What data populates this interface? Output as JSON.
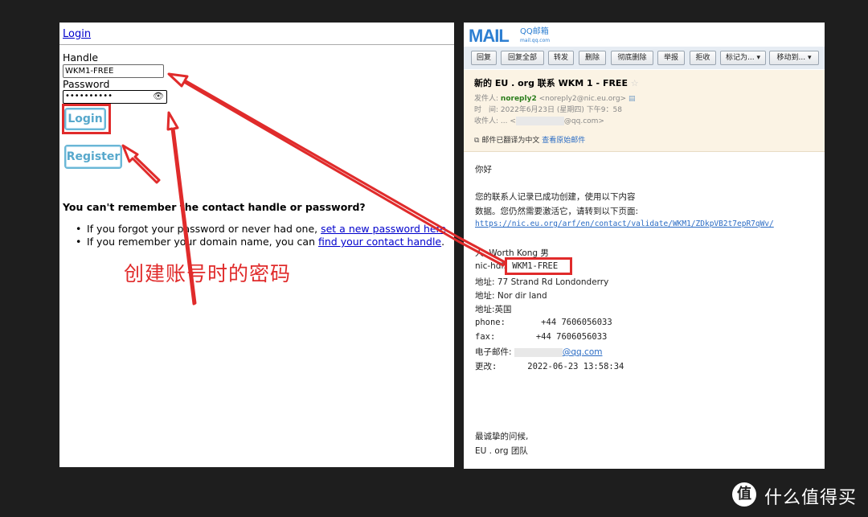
{
  "left": {
    "login_link": "Login",
    "handle_label": "Handle",
    "handle_value": "WKM1-FREE",
    "password_label": "Password",
    "password_value": "••••••••••",
    "login_button": "Login",
    "register_button": "Register",
    "question": "You can't remember the contact handle or password?",
    "bullets": [
      {
        "text": "If you forgot your password or never had one, ",
        "link": "set a new password here",
        "end": "."
      },
      {
        "text": "If you remember your domain name, you can ",
        "link": "find your contact handle",
        "end": "."
      }
    ],
    "annotation": "创建账号时的密码"
  },
  "right": {
    "logo": "MAIL",
    "logo_cn": "QQ邮箱",
    "logo_domain": "mail.qq.com",
    "toolbar": [
      "回复",
      "回复全部",
      "转发",
      "删除",
      "彻底删除",
      "举报",
      "拒收",
      "标记为...",
      "移动到..."
    ],
    "subject": "新的 EU . org 联系 WKM 1 - FREE",
    "star": "☆",
    "sender_label": "发件人:",
    "sender_name": "noreply2",
    "sender_addr": "<noreply2@nic.eu.org>",
    "time_label": "时　间:",
    "time_value": "2022年6月23日 (星期四) 下午9：58",
    "recipient_label": "收件人:",
    "recipient_value": "... <",
    "recipient_domain": "@qq.com>",
    "translated_note": "邮件已翻译为中文",
    "view_original": "查看原始邮件",
    "greeting": "你好",
    "line1": "您的联系人记录已成功创建，使用以下内容",
    "line2": "数据。您仍然需要激活它，请转到以下页面:",
    "link": "https://nic.eu.org/arf/en/contact/validate/WKM1/ZDkpVB2t7epR7qWv/",
    "name_line": "人: Worth Kong 男",
    "nic_label": "nic-hdl:",
    "nic_value": "WKM1-FREE",
    "addr1": "地址: 77 Strand Rd Londonderry",
    "addr2": "地址: Nor dir land",
    "addr3": "地址:英国",
    "phone": "phone:       +44 7606056033",
    "fax": "fax:        +44 7606056033",
    "email_label": "电子邮件:",
    "email_domain": "@qq.com",
    "changed": "更改:      2022-06-23 13:58:34",
    "regards": "最诚挚的问候,",
    "team": "EU . org 团队"
  },
  "watermark": {
    "logo": "值",
    "text": "什么值得买"
  }
}
